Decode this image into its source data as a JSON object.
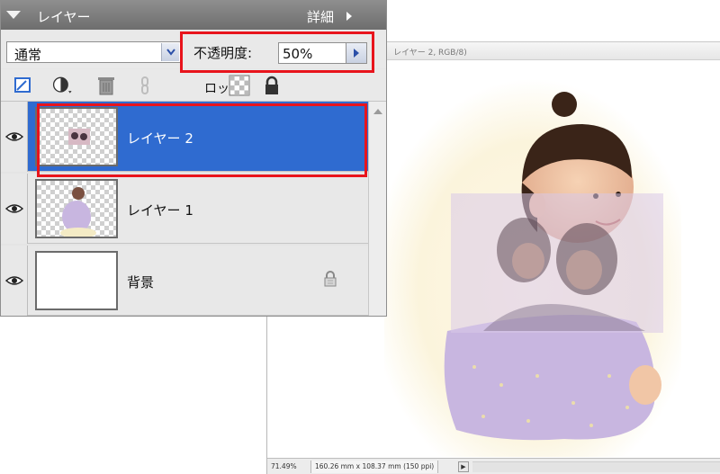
{
  "document": {
    "title": "レイヤー 2, RGB/8)",
    "zoom": "71.49%",
    "doc_size": "160.26 mm x 108.37 mm (150 ppi)",
    "status_arrow": "▶"
  },
  "panel": {
    "title": "レイヤー",
    "more_label": "詳細",
    "blend_mode": "通常",
    "opacity_label": "不透明度:",
    "opacity_value": "50%",
    "lock_label": "ロック:",
    "tools": [
      "new-layer-icon",
      "adjustment-layer-icon",
      "trash-icon",
      "link-icon",
      "lock-transparency-icon",
      "lock-all-icon"
    ]
  },
  "layers": [
    {
      "name": "レイヤー 2",
      "selected": true,
      "visible": true,
      "thumbnail": "transparent-with-small-photo"
    },
    {
      "name": "レイヤー 1",
      "selected": false,
      "visible": true,
      "thumbnail": "transparent-with-child"
    },
    {
      "name": "背景",
      "selected": false,
      "visible": true,
      "locked": true,
      "thumbnail": "white"
    }
  ],
  "colors": {
    "selection": "#2f6bd0",
    "highlight_box": "#e8141c",
    "panel_header": "#7a7a7a"
  }
}
